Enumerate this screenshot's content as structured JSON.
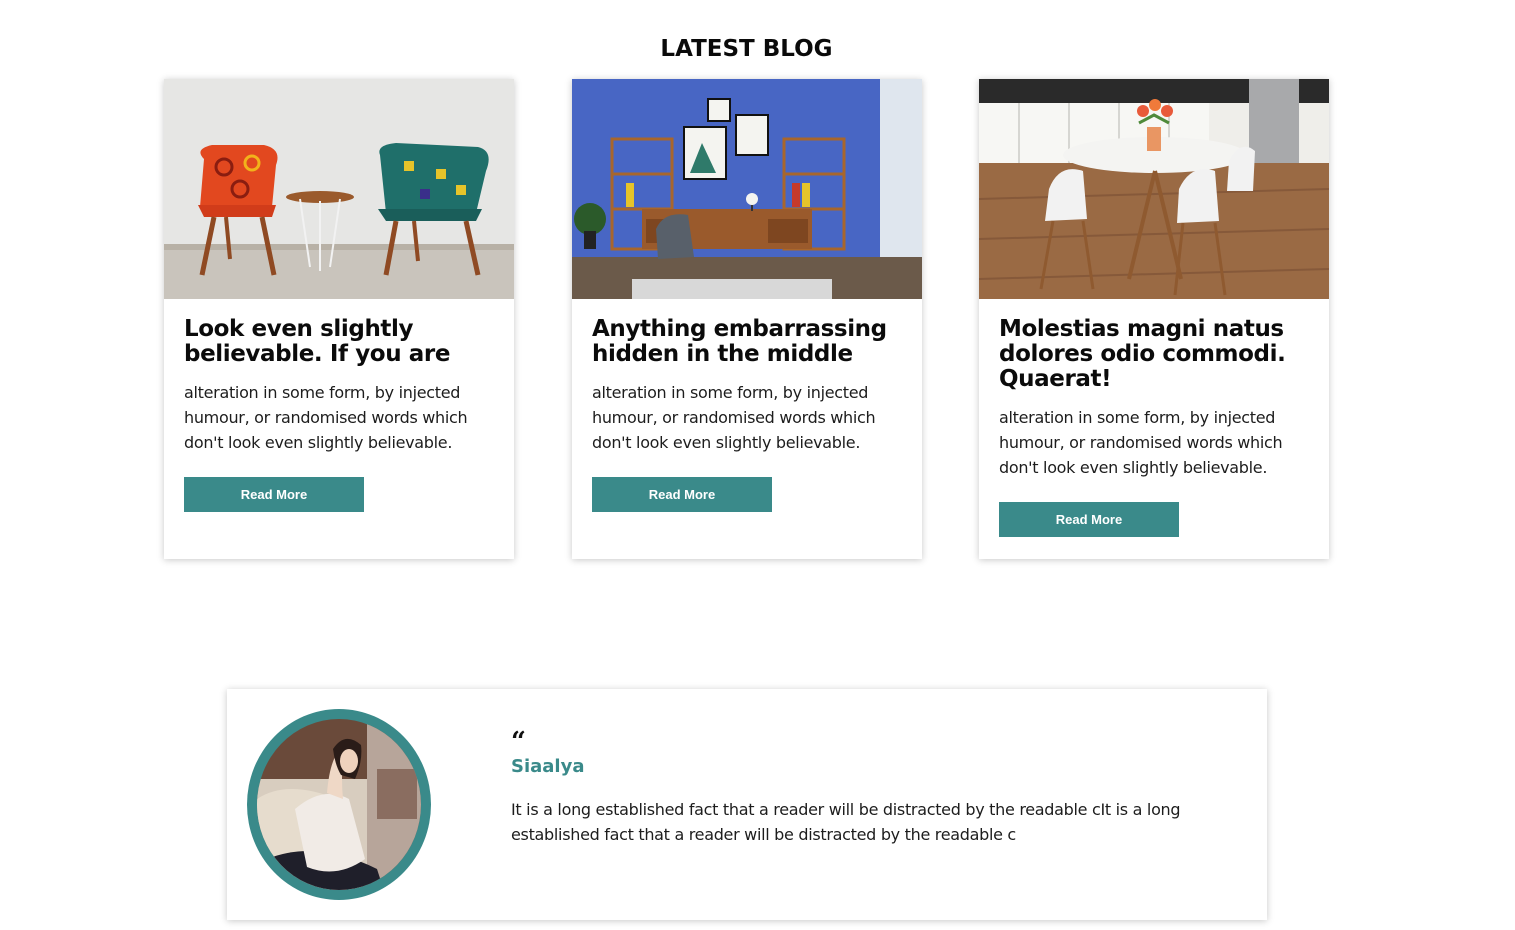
{
  "colors": {
    "accent": "#3a8a8a",
    "heading": "#0b0b0b",
    "body_text": "#1d1d1d",
    "background": "#ffffff"
  },
  "blog": {
    "title": "LATEST BLOG",
    "posts": [
      {
        "image": "photo-two-patterned-armchairs",
        "title": "Look even slightly believable. If you are",
        "excerpt": "alteration in some form, by injected humour, or randomised words which don't look even slightly believable.",
        "button_label": "Read More"
      },
      {
        "image": "photo-blue-home-office",
        "title": "Anything embarrassing hidden in the middle",
        "excerpt": "alteration in some form, by injected humour, or randomised words which don't look even slightly believable.",
        "button_label": "Read More"
      },
      {
        "image": "photo-white-dining-table-kitchen",
        "title": "Molestias magni natus dolores odio commodi. Quaerat!",
        "excerpt": "alteration in some form, by injected humour, or randomised words which don't look even slightly believable.",
        "button_label": "Read More"
      }
    ]
  },
  "testimonial": {
    "avatar": "photo-woman-on-sofa",
    "quote_icon": "quote-icon",
    "quote_mark": "“",
    "name": "Siaalya",
    "text": "It is a long established fact that a reader will be distracted by the readable cIt is a long established fact that a reader will be distracted by the readable c"
  }
}
